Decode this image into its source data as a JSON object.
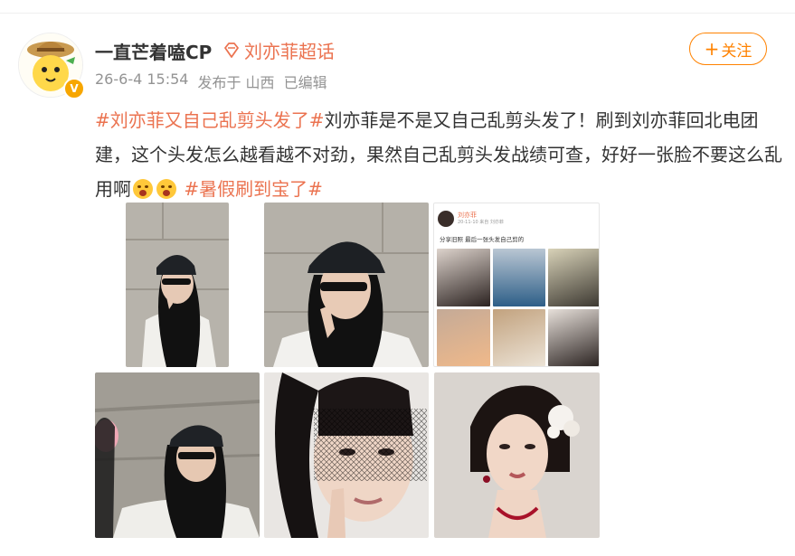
{
  "user": {
    "name": "一直芒着嗑CP",
    "topic": "刘亦菲超话",
    "verified_mark": "V"
  },
  "meta": {
    "time": "26-6-4 15:54",
    "source": "发布于 山西",
    "edited": "已编辑"
  },
  "follow": {
    "plus": "+",
    "label": "关注"
  },
  "post": {
    "hashtag1": "#刘亦菲又自己乱剪头发了#",
    "body": "刘亦菲是不是又自己乱剪头发了！刷到刘亦菲回北电团建，这个头发怎么越看越不对劲，果然自己乱剪头发战绩可查，好好一张脸不要这么乱用啊",
    "hashtag2": "#暑假刷到宝了#",
    "emoji": "haha-emoji"
  },
  "embedded_post": {
    "name": "刘亦菲",
    "meta": "20-11-10 来自 刘亦菲",
    "text": "分享旧照 最后一张头发自己剪的"
  },
  "colors": {
    "accent": "#eb7350",
    "follow": "#ff8200",
    "meta": "#939393",
    "badge": "#f7a600"
  }
}
